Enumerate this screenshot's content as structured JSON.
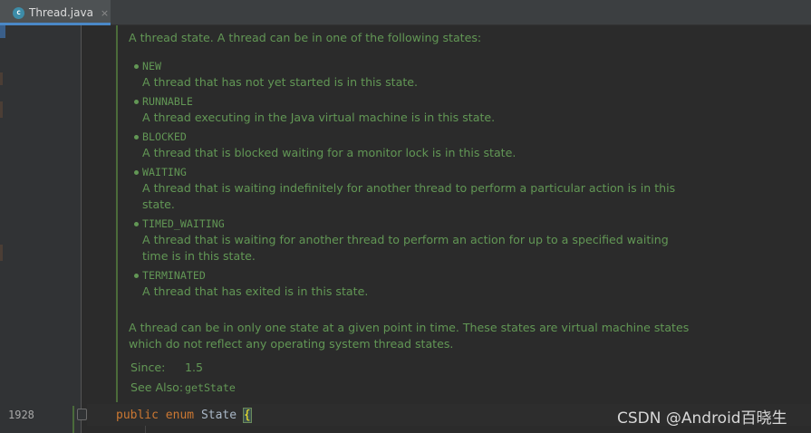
{
  "tab": {
    "icon_letter": "c",
    "label": "Thread.java",
    "close": "×"
  },
  "doc": {
    "intro": "A thread state. A thread can be in one of the following states:",
    "states": [
      {
        "name": "NEW",
        "lines": [
          "A thread that has not yet started is in this state."
        ]
      },
      {
        "name": "RUNNABLE",
        "lines": [
          "A thread executing in the Java virtual machine is in this state."
        ]
      },
      {
        "name": "BLOCKED",
        "lines": [
          "A thread that is blocked waiting for a monitor lock is in this state."
        ]
      },
      {
        "name": "WAITING",
        "lines": [
          "A thread that is waiting indefinitely for another thread to perform a particular action is in this",
          "state."
        ]
      },
      {
        "name": "TIMED_WAITING",
        "lines": [
          "A thread that is waiting for another thread to perform an action for up to a specified waiting",
          "time is in this state."
        ]
      },
      {
        "name": "TERMINATED",
        "lines": [
          "A thread that has exited is in this state."
        ]
      }
    ],
    "summary_lines": [
      "A thread can be in only one state at a given point in time. These states are virtual machine states",
      "which do not reflect any operating system thread states."
    ],
    "since_label": "Since:",
    "since_value": "1.5",
    "see_also_label": "See Also:",
    "see_also_link": "getState"
  },
  "editor": {
    "line_number": "1928",
    "kw_public": "public",
    "kw_enum": "enum",
    "identifier": "State",
    "brace": "{"
  },
  "watermark": "CSDN @Android百晓生",
  "colors": {
    "doc_text": "#629755",
    "doc_code": "#5b90c5",
    "keyword": "#cc7832",
    "identifier": "#a9b7c6",
    "background": "#2b2b2b"
  }
}
